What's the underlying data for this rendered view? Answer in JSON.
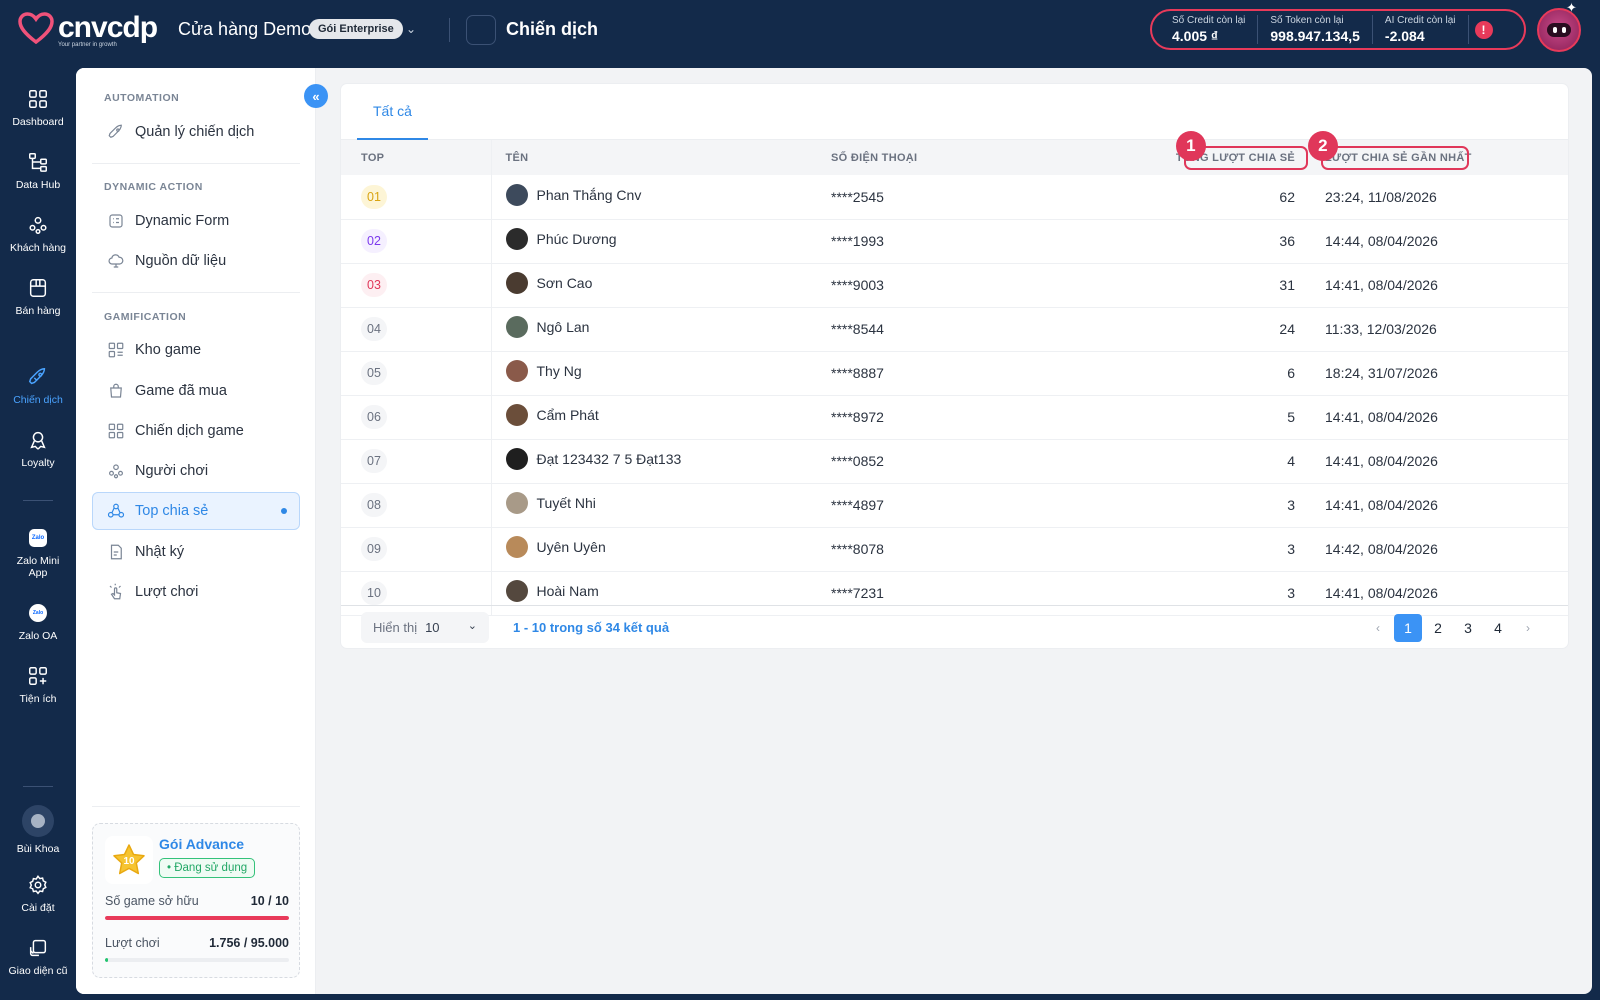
{
  "header": {
    "logo_text": "cnvcdp",
    "logo_tagline": "Your partner in growth",
    "store_name": "Cửa hàng Demo",
    "plan_badge": "Gói Enterprise",
    "page_title": "Chiến dịch",
    "credits": [
      {
        "label": "Số Credit còn lại",
        "value": "4.005 ₫"
      },
      {
        "label": "Số Token còn lại",
        "value": "998.947.134,5"
      },
      {
        "label": "AI Credit còn lại",
        "value": "-2.084"
      }
    ],
    "info_glyph": "!"
  },
  "rail": {
    "items": [
      {
        "label": "Dashboard",
        "icon": "dashboard-icon"
      },
      {
        "label": "Data Hub",
        "icon": "data-hub-icon"
      },
      {
        "label": "Khách hàng",
        "icon": "customers-icon"
      },
      {
        "label": "Bán hàng",
        "icon": "store-icon"
      },
      {
        "label": "Chiến dịch",
        "icon": "rocket-icon",
        "active": true
      },
      {
        "label": "Loyalty",
        "icon": "award-icon"
      },
      {
        "label": "Zalo Mini App",
        "icon": "zalo-mini-app-icon"
      },
      {
        "label": "Zalo OA",
        "icon": "zalo-oa-icon"
      },
      {
        "label": "Tiện ích",
        "icon": "apps-plus-icon"
      }
    ],
    "zalo_glyph": "Zalo",
    "user_name": "Bùi Khoa",
    "settings_label": "Cài đặt",
    "legacy_label": "Giao diện cũ"
  },
  "sidebar": {
    "collapse_glyph": "«",
    "sections": [
      {
        "title": "AUTOMATION",
        "items": [
          {
            "label": "Quản lý chiến dịch",
            "icon": "rocket-icon"
          }
        ]
      },
      {
        "title": "DYNAMIC ACTION",
        "items": [
          {
            "label": "Dynamic Form",
            "icon": "form-icon"
          },
          {
            "label": "Nguồn dữ liệu",
            "icon": "cloud-icon"
          }
        ]
      },
      {
        "title": "GAMIFICATION",
        "items": [
          {
            "label": "Kho game",
            "icon": "grid-icon"
          },
          {
            "label": "Game đã mua",
            "icon": "bag-icon"
          },
          {
            "label": "Chiến dịch game",
            "icon": "grid-icon"
          },
          {
            "label": "Người chơi",
            "icon": "players-icon"
          },
          {
            "label": "Top chia sẻ",
            "icon": "share-icon",
            "active": true
          },
          {
            "label": "Nhật ký",
            "icon": "log-icon"
          },
          {
            "label": "Lượt chơi",
            "icon": "tap-icon"
          }
        ]
      }
    ],
    "plan_card": {
      "star_number": "10",
      "name": "Gói Advance",
      "status": "• Đang sử dụng",
      "games_label": "Số game sở hữu",
      "games_value": "10 / 10",
      "games_fraction": 1.0,
      "plays_label": "Lượt chơi",
      "plays_value": "1.756 / 95.000",
      "plays_fraction": 0.018
    }
  },
  "main": {
    "tab_label": "Tất cả",
    "columns": {
      "top": "TOP",
      "name": "TÊN",
      "phone": "SỐ ĐIỆN THOẠI",
      "total": "TỔNG LƯỢT CHIA SẺ",
      "last": "LƯỢT CHIA SẺ GẦN NHẤT"
    },
    "annotations": [
      "1",
      "2"
    ],
    "rows": [
      {
        "rank": "01",
        "name": "Phan Thắng Cnv",
        "phone": "****2545",
        "total": "62",
        "last": "23:24, 11/08/2026"
      },
      {
        "rank": "02",
        "name": "Phúc Dương",
        "phone": "****1993",
        "total": "36",
        "last": "14:44, 08/04/2026"
      },
      {
        "rank": "03",
        "name": "Sơn Cao",
        "phone": "****9003",
        "total": "31",
        "last": "14:41, 08/04/2026"
      },
      {
        "rank": "04",
        "name": "Ngô Lan",
        "phone": "****8544",
        "total": "24",
        "last": "11:33, 12/03/2026"
      },
      {
        "rank": "05",
        "name": "Thy Ng",
        "phone": "****8887",
        "total": "6",
        "last": "18:24, 31/07/2026"
      },
      {
        "rank": "06",
        "name": "Cẩm Phát",
        "phone": "****8972",
        "total": "5",
        "last": "14:41, 08/04/2026"
      },
      {
        "rank": "07",
        "name": "Đạt 123432 7 5 Đạt133",
        "phone": "****0852",
        "total": "4",
        "last": "14:41, 08/04/2026"
      },
      {
        "rank": "08",
        "name": "Tuyết Nhi",
        "phone": "****4897",
        "total": "3",
        "last": "14:41, 08/04/2026"
      },
      {
        "rank": "09",
        "name": "Uyên Uyên",
        "phone": "****8078",
        "total": "3",
        "last": "14:42, 08/04/2026"
      },
      {
        "rank": "10",
        "name": "Hoài Nam",
        "phone": "****7231",
        "total": "3",
        "last": "14:41, 08/04/2026"
      }
    ],
    "footer": {
      "show_label": "Hiển thị",
      "page_size": "10",
      "result_text": "1 - 10 trong số 34 kết quả",
      "pages": [
        "1",
        "2",
        "3",
        "4"
      ],
      "current_page": "1"
    }
  },
  "colors": {
    "navy": "#132a4a",
    "accent": "#2f88e6",
    "highlight": "#e0375a",
    "success": "#22a866"
  }
}
